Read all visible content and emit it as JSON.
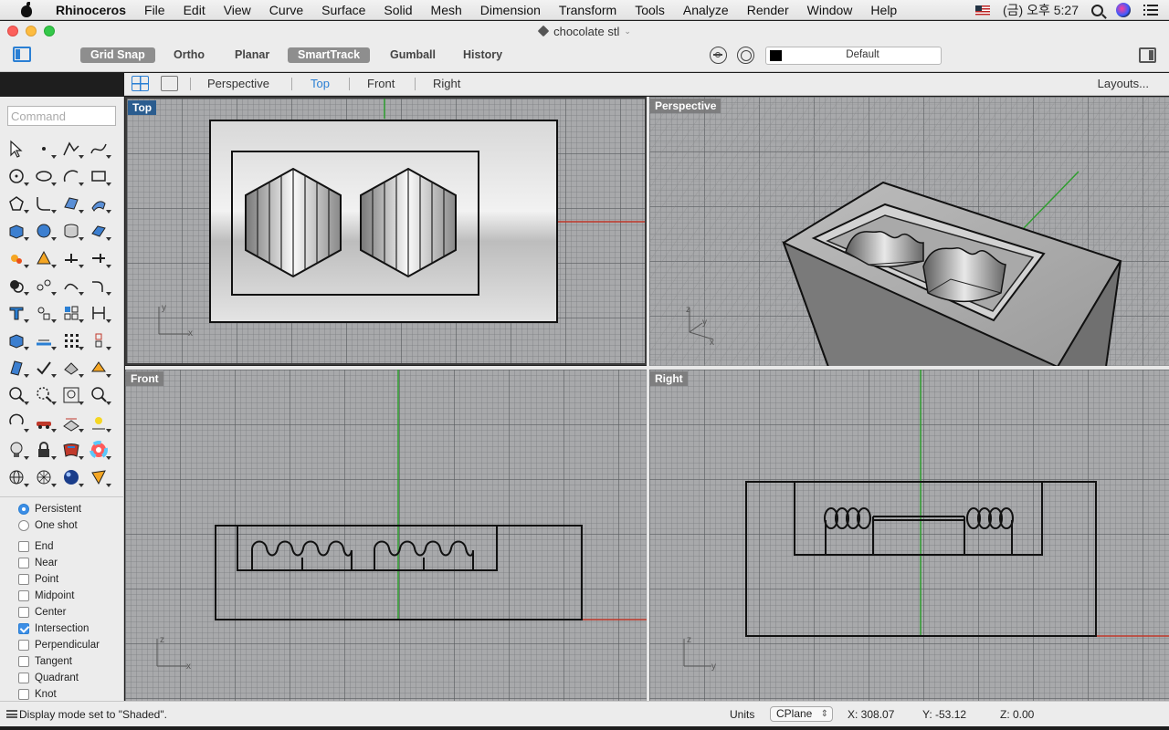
{
  "menubar": {
    "app_name": "Rhinoceros",
    "items": [
      "File",
      "Edit",
      "View",
      "Curve",
      "Surface",
      "Solid",
      "Mesh",
      "Dimension",
      "Transform",
      "Tools",
      "Analyze",
      "Render",
      "Window",
      "Help"
    ],
    "clock": "(금) 오후 5:27"
  },
  "window": {
    "title": "chocolate stl"
  },
  "toolbar": {
    "modes": [
      {
        "label": "Grid Snap",
        "on": true
      },
      {
        "label": "Ortho",
        "on": false
      },
      {
        "label": "Planar",
        "on": false
      },
      {
        "label": "SmartTrack",
        "on": true
      },
      {
        "label": "Gumball",
        "on": false
      },
      {
        "label": "History",
        "on": false
      }
    ],
    "layer_name": "Default",
    "layer_color": "#000000"
  },
  "tabs": {
    "items": [
      "Perspective",
      "Top",
      "Front",
      "Right"
    ],
    "active": "Top",
    "layouts_label": "Layouts..."
  },
  "sidebar": {
    "command_placeholder": "Command",
    "tool_icons": [
      "select-arrow-icon",
      "point-icon",
      "polyline-icon",
      "curve-icon",
      "circle-icon",
      "ellipse-icon",
      "arc-icon",
      "rectangle-icon",
      "polygon-icon",
      "fillet-icon",
      "surface-pt-icon",
      "loft-icon",
      "box-icon",
      "sphere-icon",
      "cylinder-icon",
      "extrude-icon",
      "explode-icon",
      "split-icon",
      "trim-icon",
      "extend-icon",
      "boolean-icon",
      "join-icon",
      "offset-icon",
      "blend-icon",
      "text-icon",
      "group-icon",
      "array-icon",
      "dimension-icon",
      "box-edit-icon",
      "gradient-icon",
      "grid-icon",
      "transform-icon",
      "analyze-icon",
      "check-icon",
      "fold-icon",
      "layer-icon",
      "zoom-icon",
      "zoom-window-icon",
      "zoom-extents-icon",
      "zoom-selected-icon",
      "rotate-view-icon",
      "car-icon",
      "clipping-icon",
      "render-icon",
      "light-icon",
      "lock-icon",
      "material-icon",
      "color-wheel-icon",
      "globe-icon",
      "mesh-sphere-icon",
      "shaded-sphere-icon",
      "ruler-icon"
    ],
    "osnap_mode": [
      {
        "label": "Persistent",
        "checked": true
      },
      {
        "label": "One shot",
        "checked": false
      }
    ],
    "osnaps": [
      {
        "label": "End",
        "checked": false
      },
      {
        "label": "Near",
        "checked": false
      },
      {
        "label": "Point",
        "checked": false
      },
      {
        "label": "Midpoint",
        "checked": false
      },
      {
        "label": "Center",
        "checked": false
      },
      {
        "label": "Intersection",
        "checked": true
      },
      {
        "label": "Perpendicular",
        "checked": false
      },
      {
        "label": "Tangent",
        "checked": false
      },
      {
        "label": "Quadrant",
        "checked": false
      },
      {
        "label": "Knot",
        "checked": false
      }
    ]
  },
  "viewports": {
    "top": "Top",
    "perspective": "Perspective",
    "front": "Front",
    "right": "Right",
    "axis_labels": {
      "x": "x",
      "y": "y",
      "z": "z"
    }
  },
  "statusbar": {
    "message": "Display mode set to \"Shaded\".",
    "units_label": "Units",
    "cplane": "CPlane",
    "x": "X: 308.07",
    "y": "Y: -53.12",
    "z": "Z: 0.00"
  },
  "colors": {
    "accent": "#2a7fd4",
    "axis_x": "#c0392b",
    "axis_y": "#2e9e2e",
    "active_label": "#2b5d8f"
  }
}
